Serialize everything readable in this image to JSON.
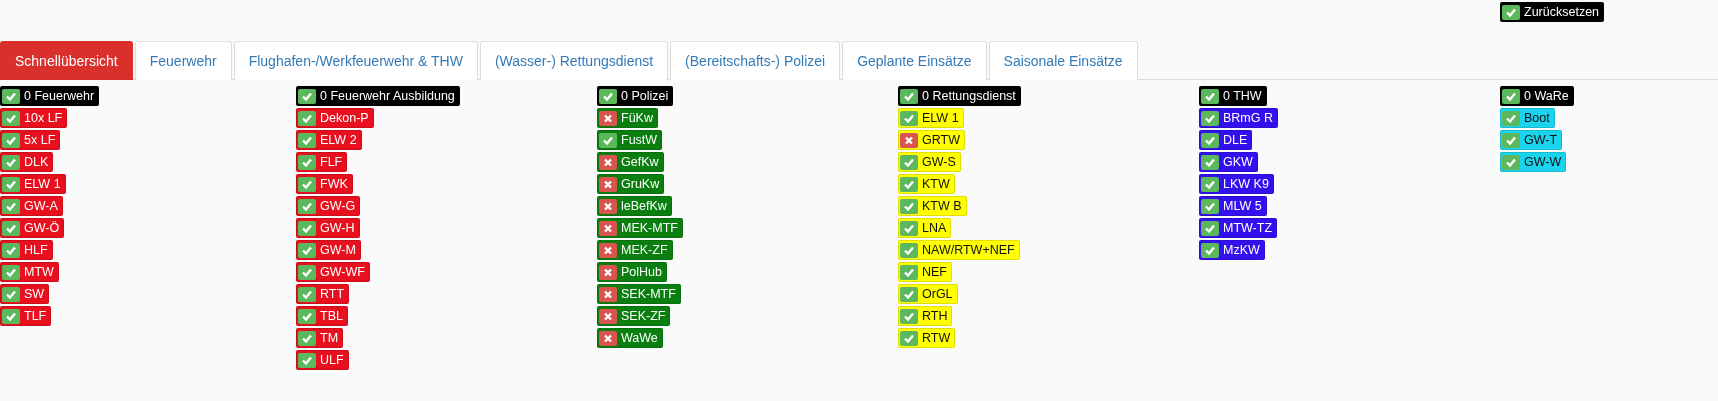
{
  "reset_button": {
    "label": "Zurücksetzen",
    "checked": true
  },
  "tabs": [
    {
      "label": "Schnellübersicht",
      "selected": true
    },
    {
      "label": "Feuerwehr",
      "selected": false
    },
    {
      "label": "Flughafen-/Werkfeuerwehr & THW",
      "selected": false
    },
    {
      "label": "(Wasser-) Rettungsdienst",
      "selected": false
    },
    {
      "label": "(Bereitschafts-) Polizei",
      "selected": false
    },
    {
      "label": "Geplante Einsätze",
      "selected": false
    },
    {
      "label": "Saisonale Einsätze",
      "selected": false
    }
  ],
  "groups": [
    {
      "header": {
        "label": "0 Feuerwehr",
        "checked": true
      },
      "color": "#e8101e",
      "items": [
        {
          "label": "10x LF",
          "checked": true
        },
        {
          "label": "5x LF",
          "checked": true
        },
        {
          "label": "DLK",
          "checked": true
        },
        {
          "label": "ELW 1",
          "checked": true
        },
        {
          "label": "GW-A",
          "checked": true
        },
        {
          "label": "GW-Ö",
          "checked": true
        },
        {
          "label": "HLF",
          "checked": true
        },
        {
          "label": "MTW",
          "checked": true
        },
        {
          "label": "SW",
          "checked": true
        },
        {
          "label": "TLF",
          "checked": true
        }
      ]
    },
    {
      "header": {
        "label": "0 Feuerwehr Ausbildung",
        "checked": true
      },
      "color": "#e8101e",
      "items": [
        {
          "label": "Dekon-P",
          "checked": true
        },
        {
          "label": "ELW 2",
          "checked": true
        },
        {
          "label": "FLF",
          "checked": true
        },
        {
          "label": "FWK",
          "checked": true
        },
        {
          "label": "GW-G",
          "checked": true
        },
        {
          "label": "GW-H",
          "checked": true
        },
        {
          "label": "GW-M",
          "checked": true
        },
        {
          "label": "GW-WF",
          "checked": true
        },
        {
          "label": "RTT",
          "checked": true
        },
        {
          "label": "TBL",
          "checked": true
        },
        {
          "label": "TM",
          "checked": true
        },
        {
          "label": "ULF",
          "checked": true
        }
      ]
    },
    {
      "header": {
        "label": "0 Polizei",
        "checked": true
      },
      "color": "#0a7f10",
      "items": [
        {
          "label": "FüKw",
          "checked": false
        },
        {
          "label": "FustW",
          "checked": true
        },
        {
          "label": "GefKw",
          "checked": false
        },
        {
          "label": "GruKw",
          "checked": false
        },
        {
          "label": "leBefKw",
          "checked": false
        },
        {
          "label": "MEK-MTF",
          "checked": false
        },
        {
          "label": "MEK-ZF",
          "checked": false
        },
        {
          "label": "PolHub",
          "checked": false
        },
        {
          "label": "SEK-MTF",
          "checked": false
        },
        {
          "label": "SEK-ZF",
          "checked": false
        },
        {
          "label": "WaWe",
          "checked": false
        }
      ]
    },
    {
      "header": {
        "label": "0 Rettungsdienst",
        "checked": true
      },
      "color": "#ffff00",
      "items": [
        {
          "label": "ELW 1",
          "checked": true
        },
        {
          "label": "GRTW",
          "checked": false
        },
        {
          "label": "GW-S",
          "checked": true
        },
        {
          "label": "KTW",
          "checked": true
        },
        {
          "label": "KTW B",
          "checked": true
        },
        {
          "label": "LNA",
          "checked": true
        },
        {
          "label": "NAW/RTW+NEF",
          "checked": true
        },
        {
          "label": "NEF",
          "checked": true
        },
        {
          "label": "OrGL",
          "checked": true
        },
        {
          "label": "RTH",
          "checked": true
        },
        {
          "label": "RTW",
          "checked": true
        }
      ]
    },
    {
      "header": {
        "label": "0 THW",
        "checked": true
      },
      "color": "#3311ee",
      "items": [
        {
          "label": "BRmG R",
          "checked": true
        },
        {
          "label": "DLE",
          "checked": true
        },
        {
          "label": "GKW",
          "checked": true
        },
        {
          "label": "LKW K9",
          "checked": true
        },
        {
          "label": "MLW 5",
          "checked": true
        },
        {
          "label": "MTW-TZ",
          "checked": true
        },
        {
          "label": "MzKW",
          "checked": true
        }
      ]
    },
    {
      "header": {
        "label": "0 WaRe",
        "checked": true
      },
      "color": "#1ad4ee",
      "items": [
        {
          "label": "Boot",
          "checked": true
        },
        {
          "label": "GW-T",
          "checked": true
        },
        {
          "label": "GW-W",
          "checked": true
        }
      ]
    }
  ]
}
